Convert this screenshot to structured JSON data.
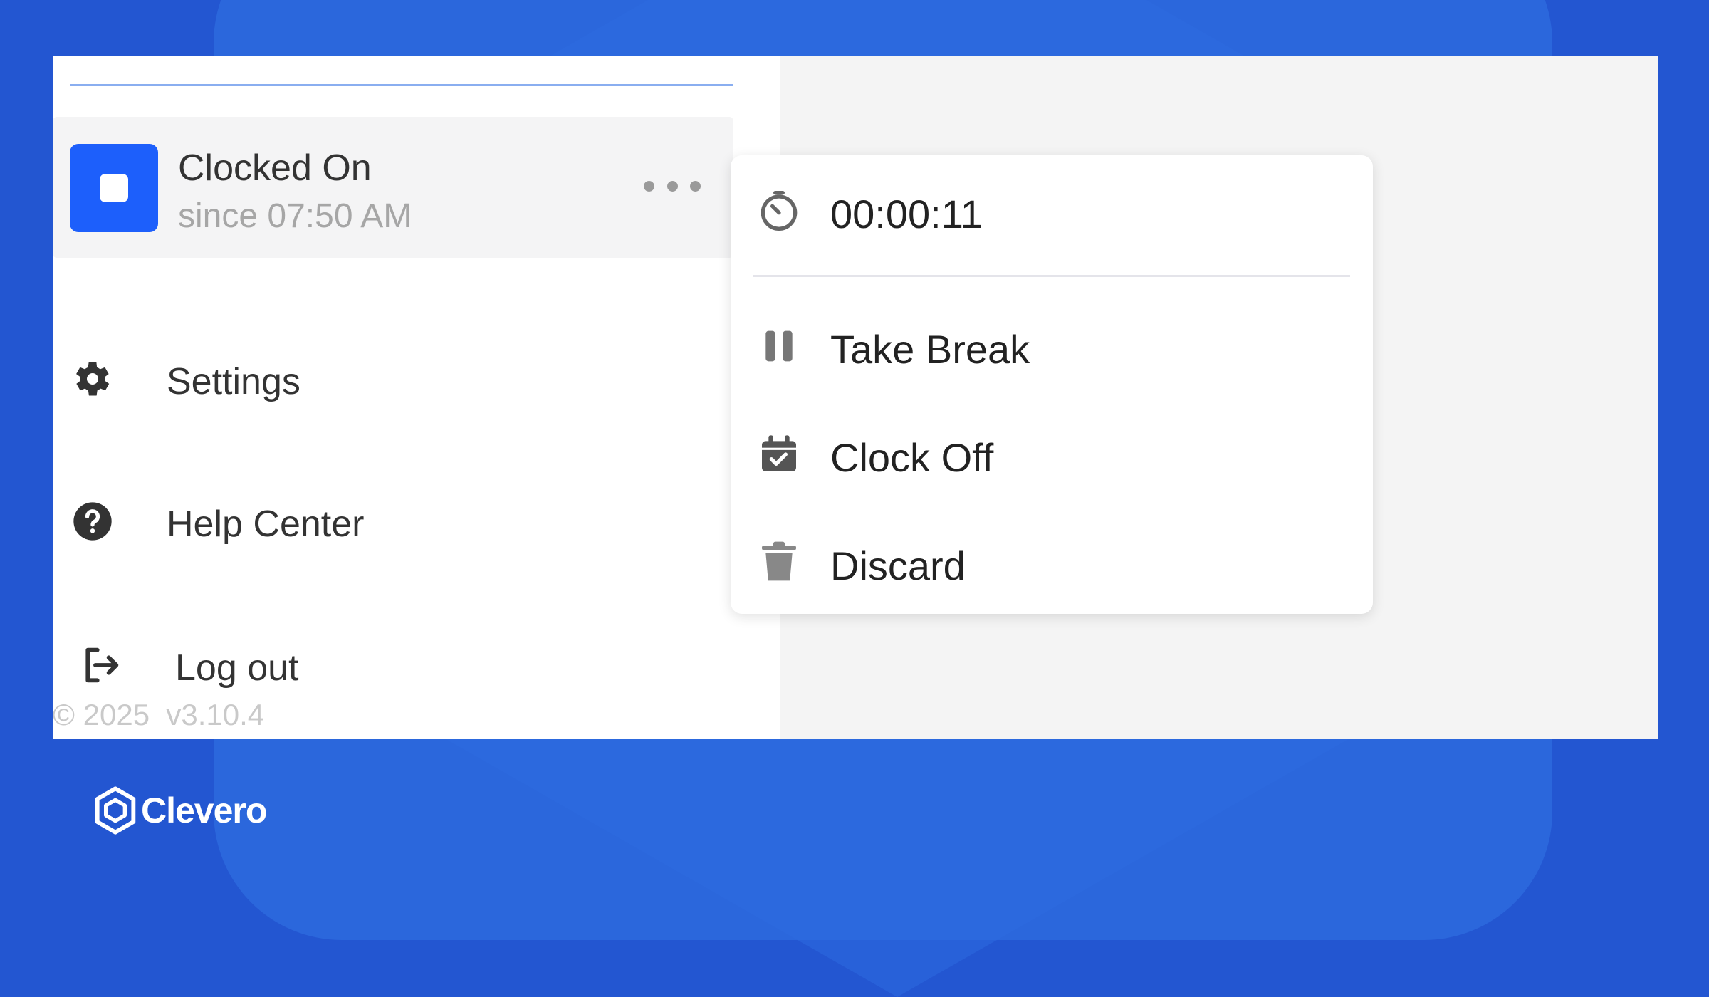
{
  "sidebar": {
    "status": {
      "title": "Clocked On",
      "since": "since 07:50 AM"
    },
    "items": [
      {
        "label": "Settings",
        "icon": "gear-icon"
      },
      {
        "label": "Help Center",
        "icon": "question-circle-icon"
      },
      {
        "label": "Log out",
        "icon": "logout-icon"
      }
    ],
    "footer": "© 2025  v3.10.4"
  },
  "popover": {
    "timer": "00:00:11",
    "actions": [
      {
        "label": "Take Break",
        "icon": "pause-icon"
      },
      {
        "label": "Clock Off",
        "icon": "calendar-check-icon"
      },
      {
        "label": "Discard",
        "icon": "trash-icon"
      }
    ]
  },
  "brand": {
    "name": "Clevero"
  },
  "colors": {
    "accent": "#1d5ffb",
    "background": "#2356d1"
  }
}
